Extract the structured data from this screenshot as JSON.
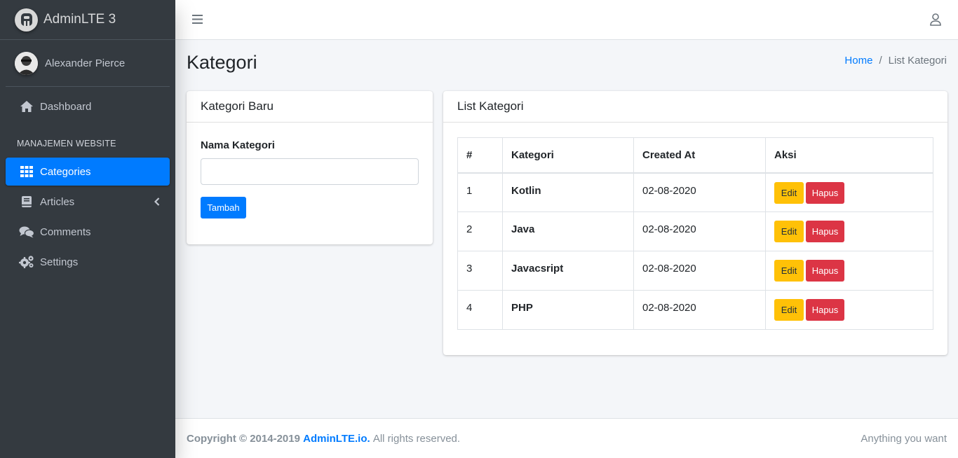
{
  "brand": {
    "name": "AdminLTE 3"
  },
  "user": {
    "name": "Alexander Pierce"
  },
  "sidebar": {
    "items": [
      {
        "label": "Dashboard",
        "icon": "home-icon"
      },
      {
        "label": "Categories",
        "icon": "grid-icon",
        "active": true
      },
      {
        "label": "Articles",
        "icon": "book-icon"
      },
      {
        "label": "Comments",
        "icon": "comments-icon"
      },
      {
        "label": "Settings",
        "icon": "cogs-icon"
      }
    ],
    "section_header": "MANAJEMEN WEBSITE"
  },
  "page": {
    "title": "Kategori",
    "breadcrumb": {
      "home": "Home",
      "separator": "/",
      "current": "List Kategori"
    }
  },
  "form_card": {
    "title": "Kategori Baru",
    "label": "Nama Kategori",
    "input_value": "",
    "submit_label": "Tambah"
  },
  "list_card": {
    "title": "List Kategori",
    "columns": [
      "#",
      "Kategori",
      "Created At",
      "Aksi"
    ],
    "rows": [
      {
        "no": "1",
        "name": "Kotlin",
        "created": "02-08-2020"
      },
      {
        "no": "2",
        "name": "Java",
        "created": "02-08-2020"
      },
      {
        "no": "3",
        "name": "Javacsript",
        "created": "02-08-2020"
      },
      {
        "no": "4",
        "name": "PHP",
        "created": "02-08-2020"
      }
    ],
    "edit_label": "Edit",
    "delete_label": "Hapus"
  },
  "footer": {
    "copyright": "Copyright © 2014-2019",
    "brand_link": "AdminLTE.io.",
    "rights": "All rights reserved.",
    "right_text": "Anything you want"
  },
  "colors": {
    "sidebar_bg": "#343a40",
    "primary": "#007bff",
    "warning": "#ffc107",
    "danger": "#dc3545",
    "content_bg": "#f4f6f9"
  }
}
